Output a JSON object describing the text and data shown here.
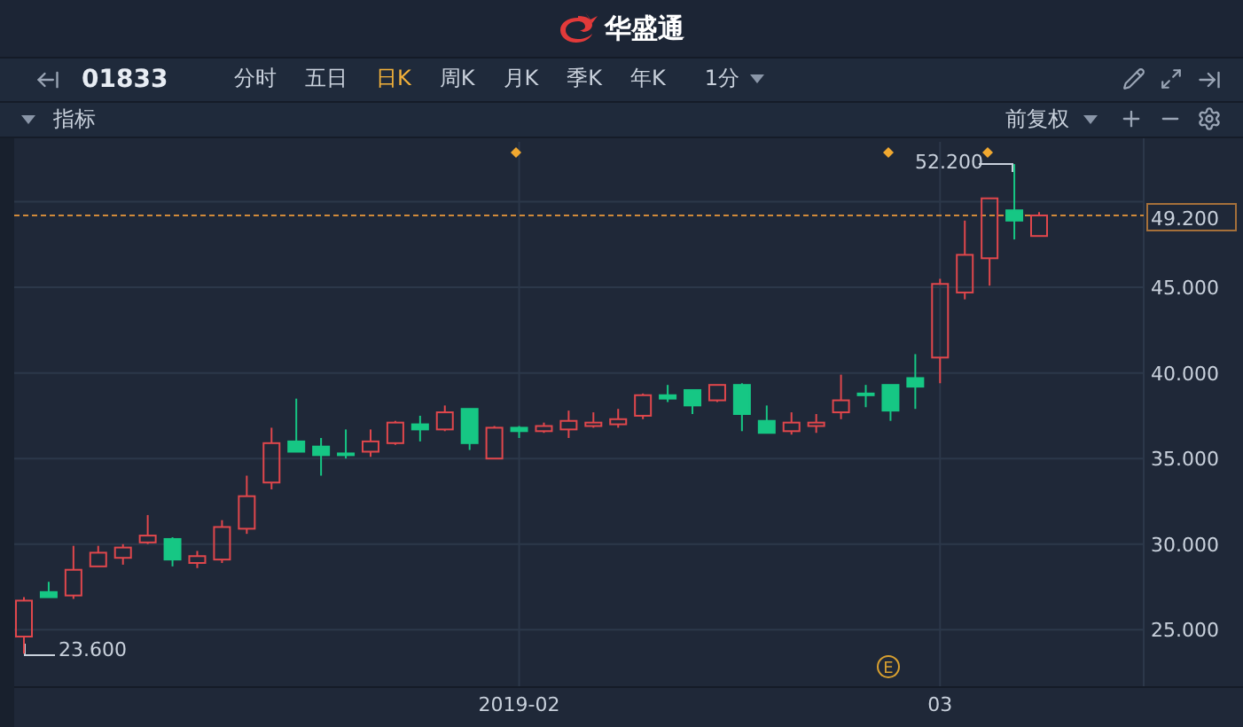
{
  "app": {
    "brand": "华盛通"
  },
  "toolbar": {
    "symbol": "01833",
    "periods": [
      {
        "label": "分时",
        "selected": false
      },
      {
        "label": "五日",
        "selected": false
      },
      {
        "label": "日K",
        "selected": true
      },
      {
        "label": "周K",
        "selected": false
      },
      {
        "label": "月K",
        "selected": false
      },
      {
        "label": "季K",
        "selected": false
      },
      {
        "label": "年K",
        "selected": false
      }
    ],
    "interval": "1分"
  },
  "indicator_bar": {
    "label": "指标",
    "adjustment": "前复权"
  },
  "chart": {
    "last_price": "49.200",
    "high_label": "52.200",
    "low_label": "23.600",
    "event_marker": "E",
    "chart_data": {
      "type": "candlestick",
      "categories": [
        null,
        null,
        null,
        null,
        null,
        null,
        null,
        null,
        null,
        null,
        null,
        null,
        null,
        null,
        null,
        null,
        null,
        null,
        null,
        null,
        "2019-02",
        null,
        null,
        null,
        null,
        null,
        null,
        null,
        null,
        null,
        null,
        null,
        null,
        null,
        null,
        null,
        null,
        "03",
        null,
        null,
        null,
        null
      ],
      "ohlc": [
        [
          24.6,
          26.9,
          23.6,
          26.7
        ],
        [
          27.2,
          27.8,
          26.9,
          26.9
        ],
        [
          27.0,
          29.9,
          26.8,
          28.5
        ],
        [
          28.7,
          29.9,
          28.7,
          29.5
        ],
        [
          29.2,
          30.0,
          28.8,
          29.8
        ],
        [
          30.1,
          31.7,
          30.0,
          30.5
        ],
        [
          30.3,
          30.4,
          28.7,
          29.1
        ],
        [
          28.9,
          29.6,
          28.6,
          29.3
        ],
        [
          29.1,
          31.4,
          28.9,
          31.0
        ],
        [
          30.9,
          34.0,
          30.6,
          32.8
        ],
        [
          33.6,
          36.8,
          33.2,
          35.9
        ],
        [
          36.0,
          38.5,
          35.4,
          35.4
        ],
        [
          35.7,
          36.2,
          34.0,
          35.2
        ],
        [
          35.3,
          36.7,
          35.0,
          35.2
        ],
        [
          35.4,
          36.7,
          35.1,
          36.0
        ],
        [
          35.9,
          37.2,
          35.8,
          37.1
        ],
        [
          37.0,
          37.5,
          36.0,
          36.7
        ],
        [
          36.7,
          38.1,
          36.6,
          37.7
        ],
        [
          37.9,
          37.9,
          35.5,
          35.9
        ],
        [
          35.0,
          36.9,
          35.0,
          36.8
        ],
        [
          36.8,
          36.9,
          36.2,
          36.6
        ],
        [
          36.6,
          37.1,
          36.5,
          36.9
        ],
        [
          36.7,
          37.8,
          36.2,
          37.2
        ],
        [
          36.9,
          37.7,
          36.8,
          37.1
        ],
        [
          37.0,
          37.9,
          36.8,
          37.3
        ],
        [
          37.5,
          38.8,
          37.3,
          38.7
        ],
        [
          38.7,
          39.3,
          38.3,
          38.5
        ],
        [
          39.0,
          39.0,
          37.6,
          38.1
        ],
        [
          38.4,
          39.3,
          38.3,
          39.3
        ],
        [
          39.3,
          39.4,
          36.6,
          37.6
        ],
        [
          37.2,
          38.1,
          36.5,
          36.5
        ],
        [
          36.6,
          37.7,
          36.4,
          37.1
        ],
        [
          36.9,
          37.6,
          36.5,
          37.1
        ],
        [
          37.7,
          39.9,
          37.3,
          38.4
        ],
        [
          38.8,
          39.3,
          38.0,
          38.7
        ],
        [
          39.3,
          39.3,
          37.2,
          37.8
        ],
        [
          39.7,
          41.1,
          37.9,
          39.2
        ],
        [
          40.9,
          45.5,
          39.4,
          45.2
        ],
        [
          44.7,
          48.9,
          44.3,
          46.9
        ],
        [
          46.7,
          50.2,
          45.1,
          50.2
        ],
        [
          49.5,
          52.2,
          47.8,
          48.9
        ],
        [
          48.0,
          49.4,
          48.0,
          49.2
        ]
      ],
      "ylim": [
        21.7,
        53.5
      ],
      "grid": true,
      "ref_lines": [
        {
          "axis": "y",
          "value": 49.2,
          "color": "#d08a3a"
        }
      ],
      "yticks": [
        {
          "value": 45,
          "label": "45.000"
        },
        {
          "value": 40,
          "label": "40.000"
        },
        {
          "value": 35,
          "label": "35.000"
        },
        {
          "value": 30,
          "label": "30.000"
        },
        {
          "value": 25,
          "label": "25.000"
        }
      ]
    }
  }
}
